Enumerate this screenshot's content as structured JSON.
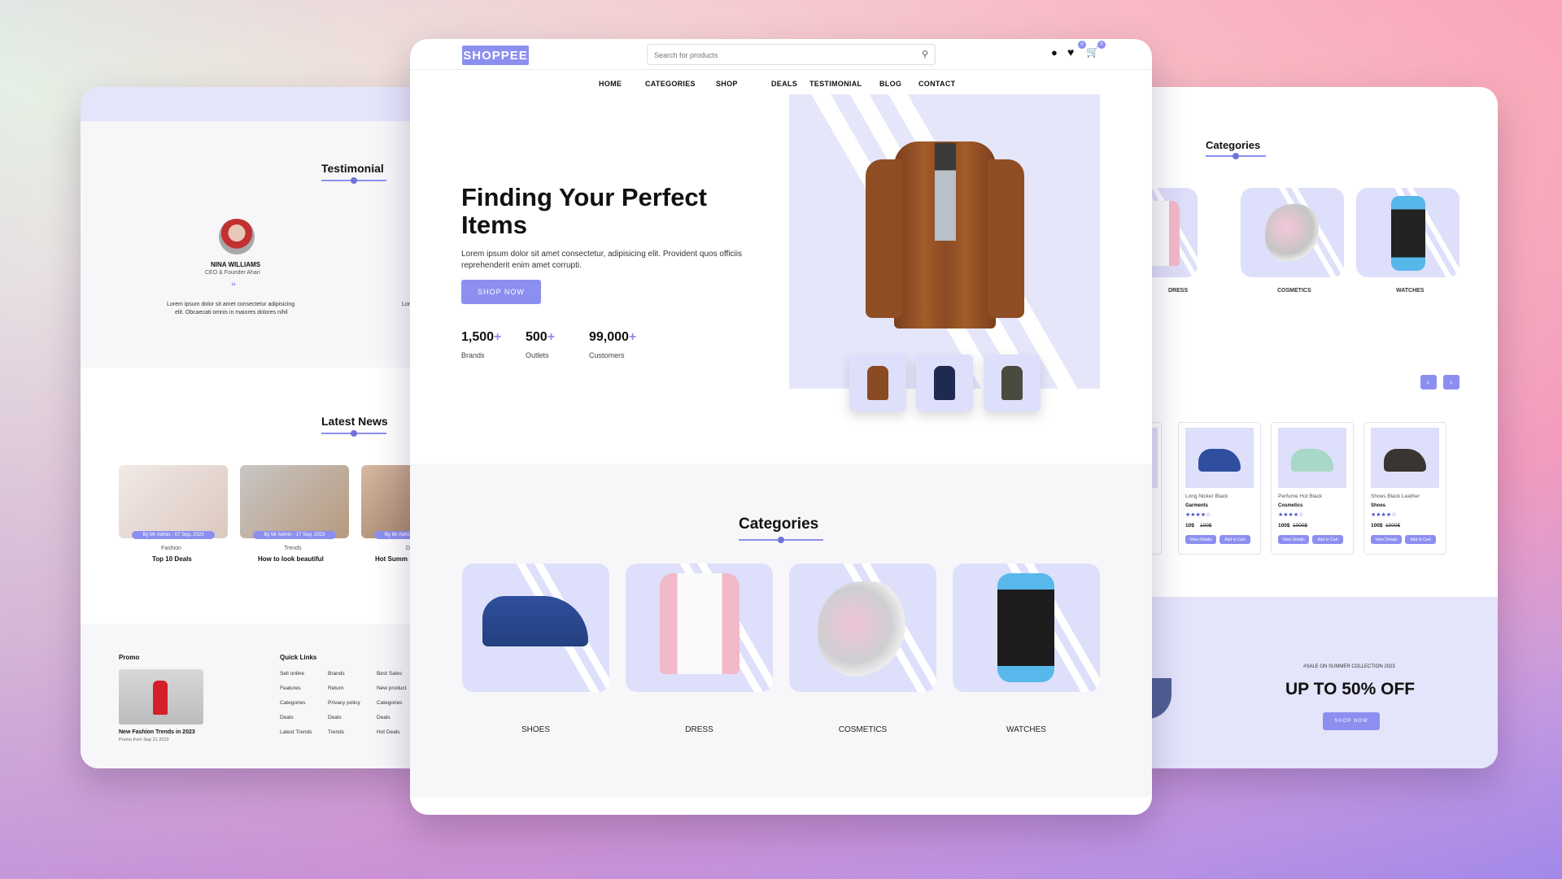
{
  "brand": "SHOPPEE",
  "search": {
    "placeholder": "Search for products"
  },
  "header": {
    "wishlist_count": "0",
    "cart_count": "0"
  },
  "nav": [
    "HOME",
    "CATEGORIES",
    "SHOP",
    "DEALS",
    "TESTIMONIAL",
    "BLOG",
    "CONTACT"
  ],
  "hero": {
    "title_line1": "Finding Your Perfect",
    "title_line2": "Items",
    "desc_line1": "Lorem ipsum dolor sit amet consectetur, adipisicing elit. Provident quos officiis",
    "desc_line2": "reprehenderit enim amet corrupti.",
    "button": "SHOP NOW",
    "stats": [
      {
        "value": "1,500",
        "label": "Brands"
      },
      {
        "value": "500",
        "label": "Outlets"
      },
      {
        "value": "99,000",
        "label": "Customers"
      }
    ]
  },
  "categories": {
    "title": "Categories",
    "items": [
      "SHOES",
      "DRESS",
      "COSMETICS",
      "WATCHES"
    ]
  },
  "left": {
    "testimonial_title": "Testimonial",
    "person_name": "NINA WILLIAMS",
    "person_role": "CEO & Founder Ahan",
    "quote_line1": "Lorem ipsum dolor sit amet consectetur adipisicing",
    "quote_line2": "elit. Obcaecati omnis in maiores dolores nihil",
    "quote_fragment": "Lor",
    "news_title": "Latest News",
    "news": [
      {
        "meta": "By Mr Admin - 07 Sep, 2023",
        "tag": "Fashion",
        "title": "Top 10 Deals"
      },
      {
        "meta": "By Mr Admin - 17 Sep, 2023",
        "tag": "Trends",
        "title": "How to look beautiful"
      },
      {
        "meta": "By Mr Admin",
        "tag": "D",
        "title": "Hot Summ"
      }
    ],
    "promo_title": "Promo",
    "promo_item": "New Fashion Trends in 2023",
    "promo_date": "Promo from Sep 21 2023",
    "quick_links_title": "Quick Links",
    "links_col1": [
      "Sell online",
      "Features",
      "Categories",
      "Deals",
      "Latest Trends"
    ],
    "links_col2": [
      "Brands",
      "Return",
      "Privacy policy",
      "Deals",
      "Trends"
    ],
    "links_col3": [
      "Best Sales",
      "New product",
      "Categories",
      "Deals",
      "Hot Deals"
    ]
  },
  "right": {
    "categories_title": "Categories",
    "items": [
      "DRESS",
      "COSMETICS",
      "WATCHES"
    ],
    "products": [
      {
        "name": "Long Nicker Black",
        "cat": "Garments",
        "price": "10$",
        "old": "100$"
      },
      {
        "name": "Perfume Hot Black",
        "cat": "Cosmetics",
        "price": "100$",
        "old": "1000$"
      },
      {
        "name": "Shoes Black Leather",
        "cat": "Shoes",
        "price": "100$",
        "old": "1000$"
      }
    ],
    "product_buttons": {
      "view": "View Details",
      "add": "Add to Cart"
    },
    "sale_tag": "#SALE ON SUMMER COLLECTION 2023",
    "sale_title": "UP TO 50% OFF",
    "sale_button": "SHOP NOW"
  },
  "colors": {
    "accent": "#8c8ff0",
    "light": "#e4e4fb"
  }
}
